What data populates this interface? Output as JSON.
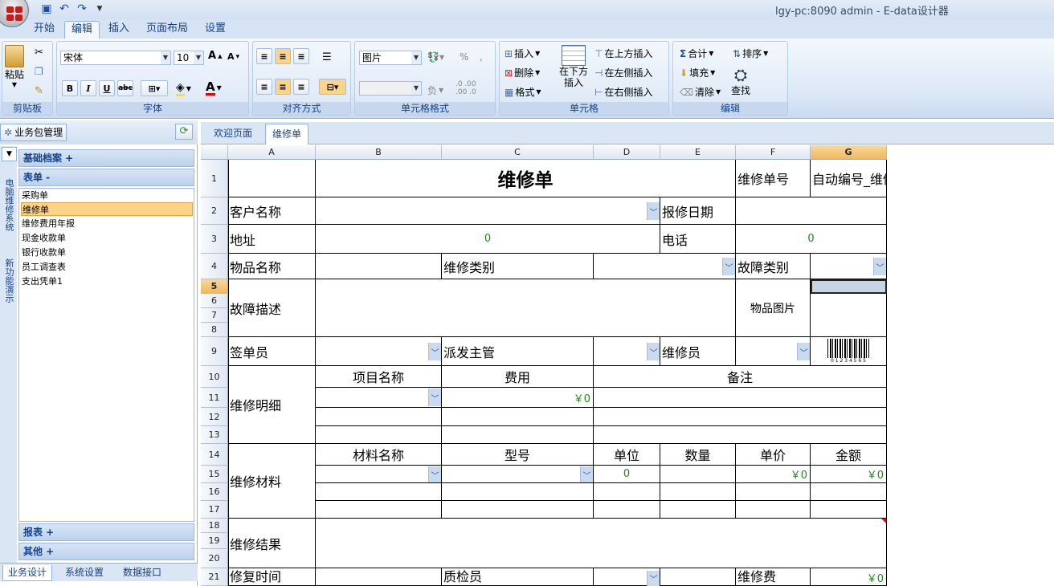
{
  "window": {
    "title": "lgy-pc:8090   admin  - E-data设计器"
  },
  "ribbon_tabs": [
    "开始",
    "编辑",
    "插入",
    "页面布局",
    "设置"
  ],
  "ribbon": {
    "clipboard": {
      "paste": "粘贴",
      "label": "剪贴板"
    },
    "font": {
      "name": "宋体",
      "size": "10",
      "label": "字体",
      "bold": "B",
      "italic": "I",
      "underline": "U",
      "strike": "abc"
    },
    "align": {
      "label": "对齐方式"
    },
    "numfmt": {
      "format": "图片",
      "percent": "%",
      "comma": ",",
      "label": "单元格格式",
      "neg": "负"
    },
    "cells": {
      "insert": "插入",
      "delete": "删除",
      "format": "格式",
      "insert_below_1": "在下方",
      "insert_below_2": "插入",
      "insert_above": "在上方插入",
      "insert_left": "在左侧插入",
      "insert_right": "在右侧插入",
      "label": "单元格"
    },
    "edit": {
      "sum": "合计",
      "fill": "填充",
      "clear": "清除",
      "sort": "排序",
      "find": "查找",
      "label": "编辑"
    }
  },
  "left": {
    "header": "业务包管理",
    "vtabs": [
      "电脑维修系统",
      "新功能演示"
    ],
    "sections": {
      "base": "基础档案 +",
      "forms": "表单 -",
      "reports": "报表 +",
      "other": "其他 +"
    },
    "items": [
      "采购单",
      "维修单",
      "维修费用年报",
      "现金收款单",
      "银行收款单",
      "员工调查表",
      "支出凭单1"
    ],
    "bottom_tabs": [
      "业务设计",
      "系统设置",
      "数据接口"
    ]
  },
  "doc_tabs": [
    "欢迎页面",
    "维修单"
  ],
  "sheet": {
    "columns": [
      "A",
      "B",
      "C",
      "D",
      "E",
      "F",
      "G"
    ],
    "rows": [
      "1",
      "2",
      "3",
      "4",
      "5",
      "6",
      "7",
      "8",
      "9",
      "10",
      "11",
      "12",
      "13",
      "14",
      "15",
      "16",
      "17",
      "18",
      "19",
      "20",
      "21"
    ],
    "title": "维修单",
    "labels": {
      "repair_no": "维修单号",
      "auto_no": "自动编号_维修",
      "customer": "客户名称",
      "report_date": "报修日期",
      "address": "地址",
      "phone": "电话",
      "zero1": "0",
      "zero2": "0",
      "item_name": "物品名称",
      "repair_type": "维修类别",
      "fault_type": "故障类别",
      "fault_desc": "故障描述",
      "item_pic": "物品图片",
      "signer": "签单员",
      "dispatcher": "派发主管",
      "repairer": "维修员",
      "detail": "维修明细",
      "project": "项目名称",
      "cost": "费用",
      "remark": "备注",
      "yen0_a": "￥0",
      "materials": "维修材料",
      "mat_name": "材料名称",
      "model": "型号",
      "unit": "单位",
      "qty": "数量",
      "price": "单价",
      "amount": "金额",
      "zero3": "0",
      "yen0_b": "￥0",
      "yen0_c": "￥0",
      "result": "维修结果",
      "barcode_digits": "0 1 2 3 4 5 6 5",
      "row21_a": "修复时间",
      "row21_b": "质检员",
      "row21_c": "维修费",
      "row21_d": "￥0"
    }
  }
}
